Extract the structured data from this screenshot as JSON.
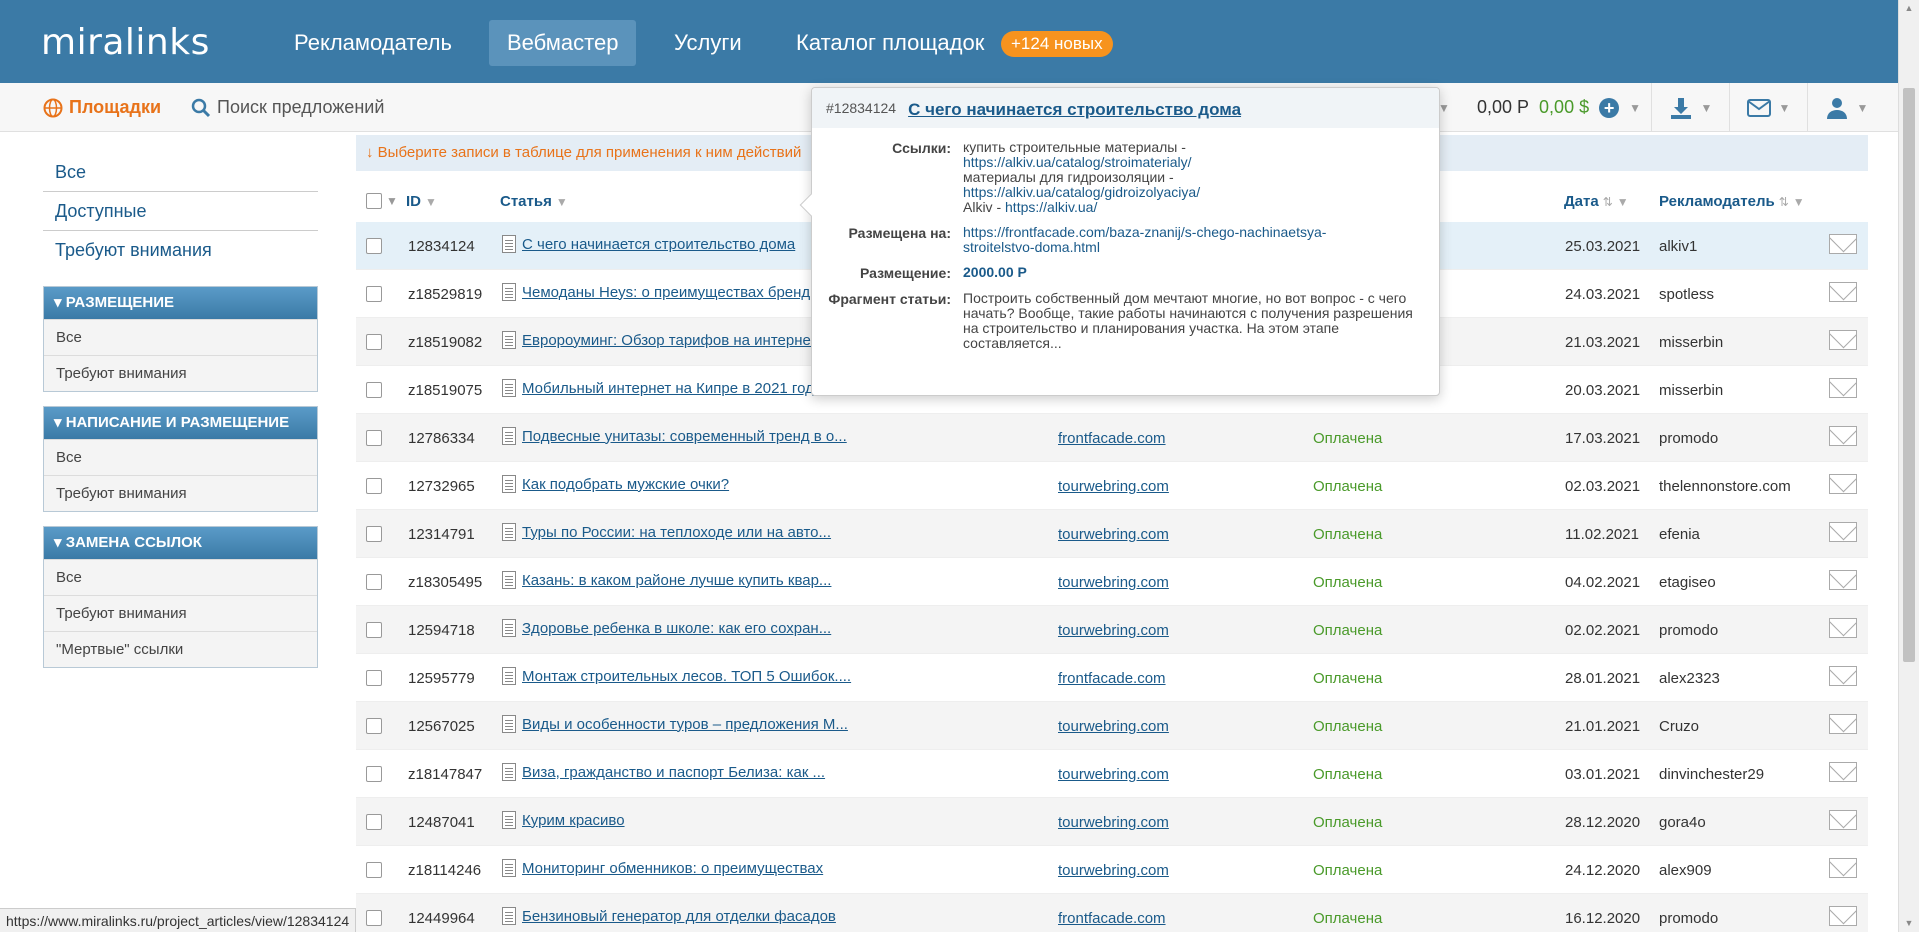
{
  "topnav": {
    "logo": "miralinks",
    "items": [
      "Рекламодатель",
      "Вебмастер",
      "Услуги",
      "Каталог площадок"
    ],
    "badge": "+124 новых"
  },
  "subbar": {
    "platforms": "Площадки",
    "search": "Поиск предложений",
    "balance_rub": "0,00 Р",
    "balance_usd": "0,00 $"
  },
  "sidebar": {
    "links": [
      "Все",
      "Доступные",
      "Требуют внимания"
    ],
    "groups": [
      {
        "title": "РАЗМЕЩЕНИЕ",
        "items": [
          "Все",
          "Требуют внимания"
        ]
      },
      {
        "title": "НАПИСАНИЕ И РАЗМЕЩЕНИЕ",
        "items": [
          "Все",
          "Требуют внимания"
        ]
      },
      {
        "title": "ЗАМЕНА ССЫЛОК",
        "items": [
          "Все",
          "Требуют внимания",
          "\"Мертвые\" ссылки"
        ]
      }
    ]
  },
  "hint": "↓ Выберите записи в таблице для применения к ним действий",
  "table": {
    "columns": {
      "id": "ID",
      "article": "Статья",
      "date": "Дата",
      "advertiser": "Рекламодатель"
    },
    "rows": [
      {
        "id": "12834124",
        "article": "С чего начинается строительство дома",
        "site": "",
        "status": "",
        "date": "25.03.2021",
        "advertiser": "alkiv1"
      },
      {
        "id": "z18529819",
        "article": "Чемоданы Heys: о преимуществах бренд...",
        "site": "",
        "status": "",
        "date": "24.03.2021",
        "advertiser": "spotless"
      },
      {
        "id": "z18519082",
        "article": "Евророуминг: Обзор тарифов на интерне...",
        "site": "",
        "status": "",
        "date": "21.03.2021",
        "advertiser": "misserbin"
      },
      {
        "id": "z18519075",
        "article": "Мобильный интернет на Кипре в 2021 год...",
        "site": "",
        "status": "",
        "date": "20.03.2021",
        "advertiser": "misserbin"
      },
      {
        "id": "12786334",
        "article": "Подвесные унитазы: современный тренд в о...",
        "site": "frontfacade.com",
        "status": "Оплачена",
        "date": "17.03.2021",
        "advertiser": "promodo"
      },
      {
        "id": "12732965",
        "article": "Как подобрать мужские очки?",
        "site": "tourwebring.com",
        "status": "Оплачена",
        "date": "02.03.2021",
        "advertiser": "thelennonstore.com"
      },
      {
        "id": "12314791",
        "article": "Туры по России: на теплоходе или на авто...",
        "site": "tourwebring.com",
        "status": "Оплачена",
        "date": "11.02.2021",
        "advertiser": "efenia"
      },
      {
        "id": "z18305495",
        "article": "Казань: в каком районе лучше купить квар...",
        "site": "tourwebring.com",
        "status": "Оплачена",
        "date": "04.02.2021",
        "advertiser": "etagiseo"
      },
      {
        "id": "12594718",
        "article": "Здоровье ребенка в школе: как его сохран...",
        "site": "tourwebring.com",
        "status": "Оплачена",
        "date": "02.02.2021",
        "advertiser": "promodo"
      },
      {
        "id": "12595779",
        "article": "Монтаж строительных лесов. ТОП 5 Ошибок....",
        "site": "frontfacade.com",
        "status": "Оплачена",
        "date": "28.01.2021",
        "advertiser": "alex2323"
      },
      {
        "id": "12567025",
        "article": "Виды и особенности туров – предложения М...",
        "site": "tourwebring.com",
        "status": "Оплачена",
        "date": "21.01.2021",
        "advertiser": "Cruzo"
      },
      {
        "id": "z18147847",
        "article": "Виза, гражданство и паспорт Белиза: как ...",
        "site": "tourwebring.com",
        "status": "Оплачена",
        "date": "03.01.2021",
        "advertiser": "dinvinchester29"
      },
      {
        "id": "12487041",
        "article": "Курим красиво",
        "site": "tourwebring.com",
        "status": "Оплачена",
        "date": "28.12.2020",
        "advertiser": "gora4o"
      },
      {
        "id": "z18114246",
        "article": "Мониторинг обменников: о преимуществах",
        "site": "tourwebring.com",
        "status": "Оплачена",
        "date": "24.12.2020",
        "advertiser": "alex909"
      },
      {
        "id": "12449964",
        "article": "Бензиновый генератор для отделки фасадов",
        "site": "frontfacade.com",
        "status": "Оплачена",
        "date": "16.12.2020",
        "advertiser": "promodo"
      }
    ]
  },
  "popover": {
    "id": "#12834124",
    "title": "С чего начинается строительство дома",
    "links_label": "Ссылки:",
    "links": [
      {
        "anchor": "купить строительные материалы -",
        "url": "https://alkiv.ua/catalog/stroimaterialy/"
      },
      {
        "anchor": "материалы для гидроизоляции -",
        "url": "https://alkiv.ua/catalog/gidroizolyaciya/"
      },
      {
        "anchor": "Alkiv -",
        "url": "https://alkiv.ua/"
      }
    ],
    "placed_label": "Размещена на:",
    "placed_url_1": "https://frontfacade.com/baza-znanij/s-chego-nachinaetsya-",
    "placed_url_2": "stroitelstvo-doma.html",
    "price_label": "Размещение:",
    "price": "2000.00 Р",
    "fragment_label": "Фрагмент статьи:",
    "fragment": "Построить собственный дом мечтают многие, но вот вопрос - с чего начать? Вообще, такие работы начинаются с получения разрешения на строительство и планирования участка. На этом этапе составляется..."
  },
  "statusbar": "https://www.miralinks.ru/project_articles/view/12834124",
  "colors": {
    "brand": "#3b7aa6",
    "accent": "#f7931e",
    "paid": "#4a9a2a"
  }
}
